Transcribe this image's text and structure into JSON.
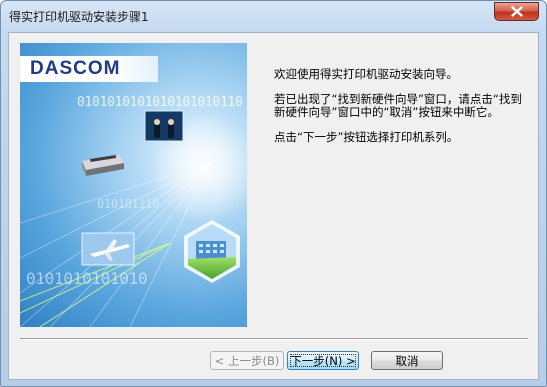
{
  "window": {
    "title": "得实打印机驱动安装步骤1",
    "close_label": "关闭"
  },
  "banner": {
    "logo": "DASCOM",
    "binary_top": "0101010101010101010110",
    "binary_mid": "010101110",
    "binary_bottom": "0101010101010"
  },
  "content": {
    "welcome": "欢迎使用得实打印机驱动安装向导。",
    "instruction": "若已出现了“找到新硬件向导”窗口，请点击“找到新硬件向导”窗口中的“取消”按钮来中断它。",
    "next_hint": "点击“下一步”按钮选择打印机系列。"
  },
  "buttons": {
    "back": "< 上一步(B)",
    "next": "下一步(N) >",
    "cancel": "取消"
  },
  "colors": {
    "close_button": "#c1321f",
    "logo": "#1f3b86",
    "banner_blue": "#5aa6de"
  }
}
